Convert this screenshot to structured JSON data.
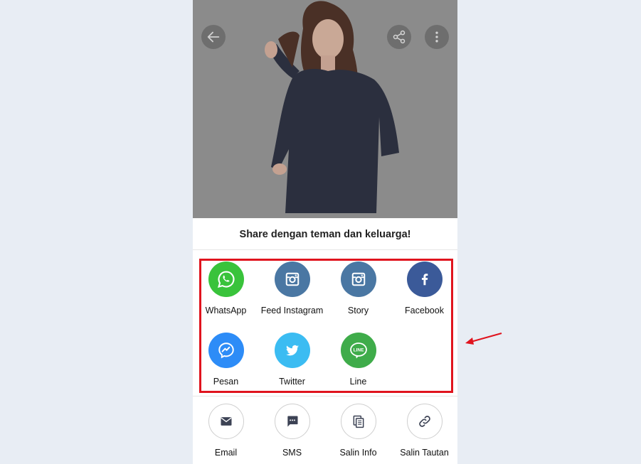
{
  "sheet": {
    "title": "Share dengan teman dan keluarga!"
  },
  "share_apps": [
    {
      "label": "WhatsApp",
      "icon": "whatsapp-icon",
      "color": "#39c33b"
    },
    {
      "label": "Feed Instagram",
      "icon": "instagram-icon",
      "color": "#4a77a3"
    },
    {
      "label": "Story",
      "icon": "instagram-icon",
      "color": "#4a77a3"
    },
    {
      "label": "Facebook",
      "icon": "facebook-icon",
      "color": "#3b5a99"
    },
    {
      "label": "Pesan",
      "icon": "messenger-icon",
      "color": "#2d8cf7"
    },
    {
      "label": "Twitter",
      "icon": "twitter-icon",
      "color": "#3bbcf2"
    },
    {
      "label": "Line",
      "icon": "line-icon",
      "color": "#3fac4a"
    }
  ],
  "other_options": [
    {
      "label": "Email",
      "icon": "mail-icon"
    },
    {
      "label": "SMS",
      "icon": "sms-icon"
    },
    {
      "label": "Salin Info",
      "icon": "copy-icon"
    },
    {
      "label": "Salin Tautan",
      "icon": "link-icon"
    }
  ],
  "colors": {
    "highlight": "#e0141e",
    "background": "#e8edf4",
    "overlay": "#8a8a8a"
  }
}
